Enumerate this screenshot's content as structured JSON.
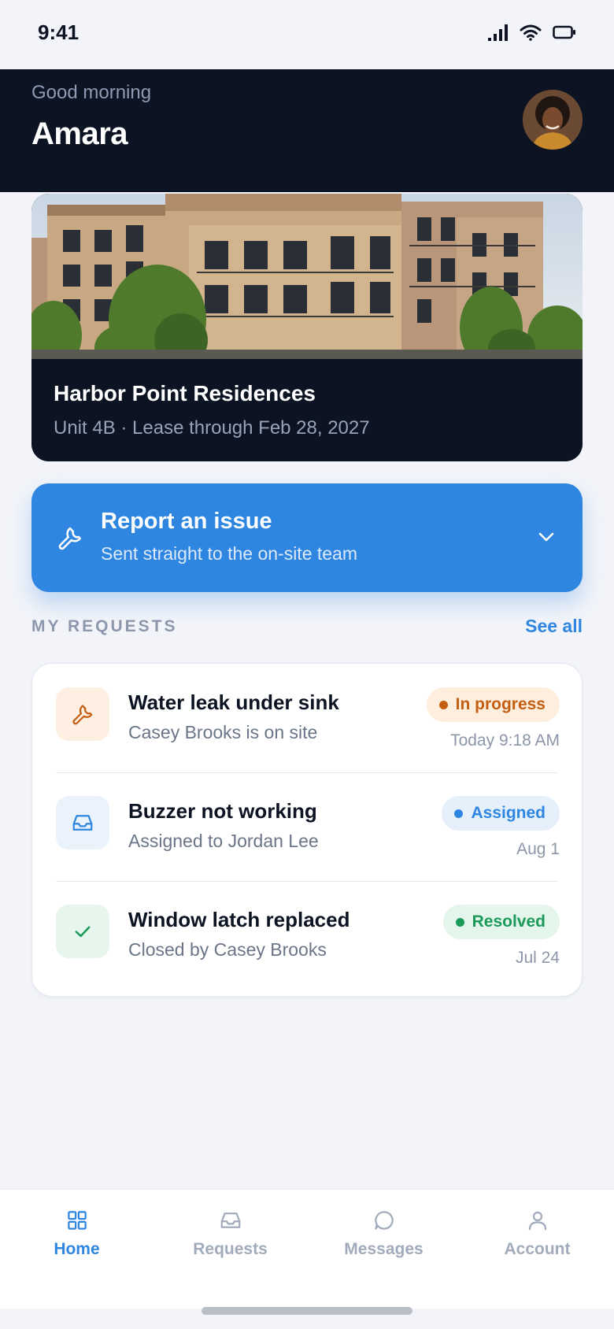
{
  "status_bar": {
    "time": "9:41"
  },
  "header": {
    "greeting": "Good morning",
    "user_name": "Amara"
  },
  "property": {
    "name": "Harbor Point Residences",
    "details": "Unit 4B · Lease through Feb 28, 2027"
  },
  "report_issue": {
    "title": "Report an issue",
    "subtitle": "Sent straight to the on-site team",
    "icon": "wrench-icon"
  },
  "requests_section": {
    "title": "MY REQUESTS",
    "see_all": "See all"
  },
  "requests": [
    {
      "title": "Water leak under sink",
      "subtitle": "Casey Brooks is on site",
      "status": "In progress",
      "time": "Today 9:18 AM",
      "icon": "wrench-icon",
      "status_color": "#c45f12",
      "status_bg": "#fdeedd",
      "icon_bg": "#fdf0e2"
    },
    {
      "title": "Buzzer not working",
      "subtitle": "Assigned to Jordan Lee",
      "status": "Assigned",
      "time": "Aug 1",
      "icon": "inbox-icon",
      "status_color": "#2f86e0",
      "status_bg": "#e6f0fb",
      "icon_bg": "#eaf2fc"
    },
    {
      "title": "Window latch replaced",
      "subtitle": "Closed by Casey Brooks",
      "status": "Resolved",
      "time": "Jul 24",
      "icon": "check-icon",
      "status_color": "#1b9a5a",
      "status_bg": "#e4f6ec",
      "icon_bg": "#e6f6ed"
    }
  ],
  "bottom_nav": [
    {
      "label": "Home",
      "icon": "grid-icon",
      "active": true
    },
    {
      "label": "Requests",
      "icon": "inbox-icon",
      "active": false
    },
    {
      "label": "Messages",
      "icon": "chat-icon",
      "active": false
    },
    {
      "label": "Account",
      "icon": "person-icon",
      "active": false
    }
  ],
  "colors": {
    "accent": "#2f86e0",
    "dark": "#0c1322",
    "background": "#f2f4f9"
  }
}
